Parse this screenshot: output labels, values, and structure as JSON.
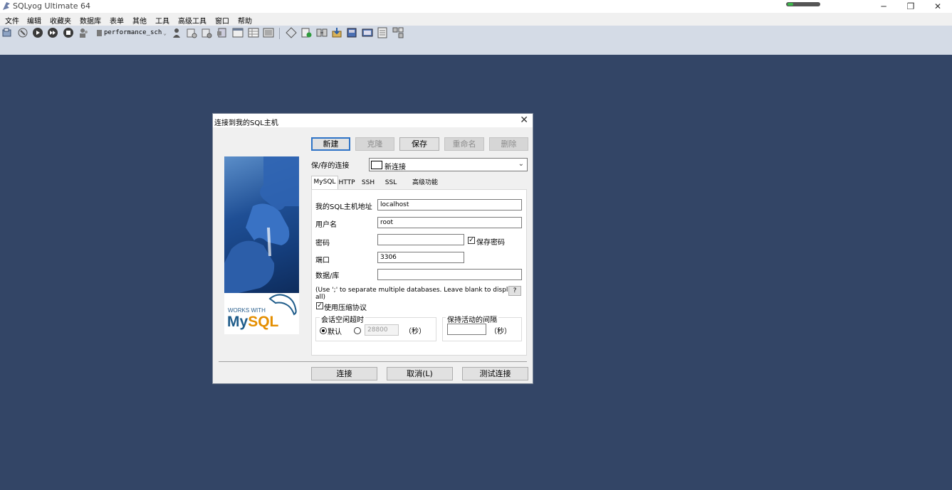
{
  "window": {
    "title": "SQLyog Ultimate 64",
    "progress_percent": 15
  },
  "menu": [
    "文件",
    "编辑",
    "收藏夹",
    "数据库",
    "表单",
    "其他",
    "工具",
    "高级工具",
    "窗口",
    "帮助"
  ],
  "toolbar": {
    "database": "performance_sch"
  },
  "dialog": {
    "title": "连接到我的SQL主机",
    "buttons": {
      "new": "新建",
      "clone": "克隆",
      "save": "保存",
      "rename": "重命名",
      "delete": "删除"
    },
    "saved_label": "保/存的连接",
    "saved_value": "新连接",
    "tabs": [
      "MySQL",
      "HTTP",
      "SSH",
      "SSL",
      "高级功能"
    ],
    "form": {
      "host_label": "我的SQL主机地址",
      "host_value": "localhost",
      "user_label": "用户名",
      "user_value": "root",
      "password_label": "密码",
      "password_value": "",
      "save_password_label": "保存密码",
      "save_password_checked": true,
      "port_label": "端口",
      "port_value": "3306",
      "database_label": "数据/库",
      "database_value": "",
      "hint": "(Use ';' to separate multiple databases. Leave blank to display all)",
      "help_label": "?",
      "compress_label": "使用压缩协议",
      "compress_checked": true,
      "session_timeout_title": "会话空闲超时",
      "default_label": "默认",
      "timeout_value": "28800",
      "seconds_label": "（秒）",
      "keepalive_title": "保持活动的间隔",
      "keepalive_value": "",
      "keepalive_seconds_label": "（秒）"
    },
    "footer": {
      "connect": "连接",
      "cancel": "取消(L)",
      "test": "测试连接"
    },
    "logo": {
      "works_with": "WORKS WITH",
      "my": "My",
      "sql": "SQL"
    }
  }
}
